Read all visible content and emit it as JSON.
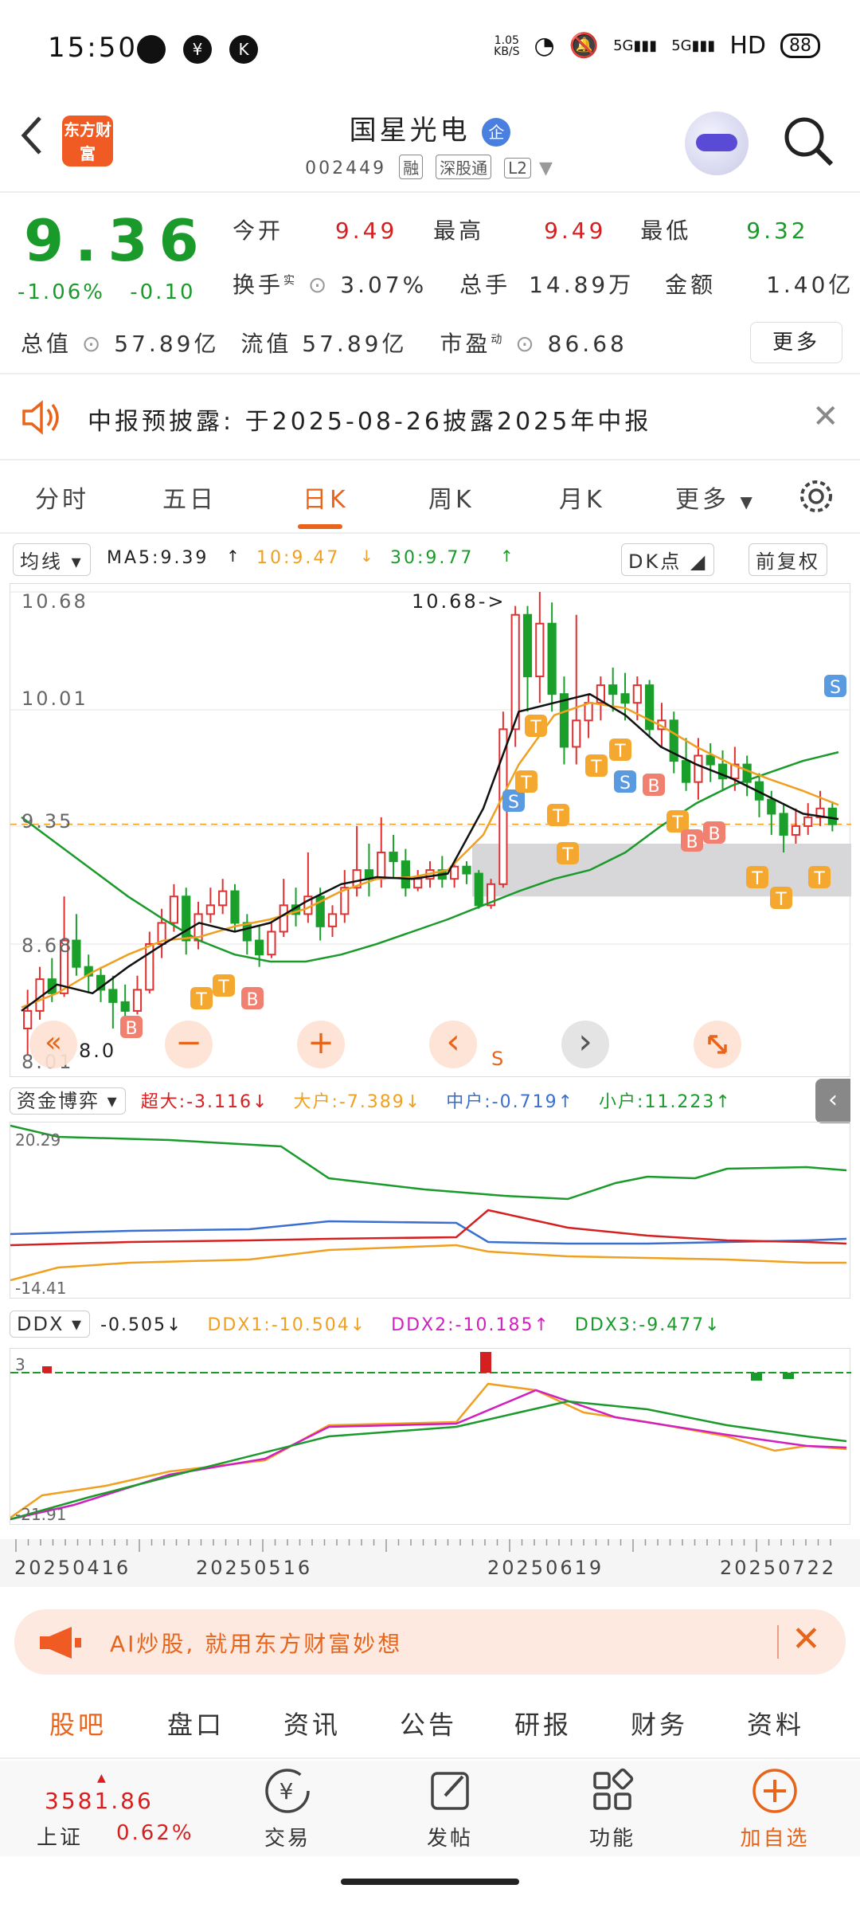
{
  "status_bar": {
    "time": "15:50",
    "net_speed": "1.05",
    "net_unit": "KB/S",
    "network": "HD",
    "battery": "88"
  },
  "header": {
    "logo_text": "东方财富",
    "stock_name": "国星光电",
    "badge": "企",
    "stock_code": "002449",
    "tags": [
      "融",
      "深股通",
      "L2"
    ]
  },
  "quote": {
    "price": "9.36",
    "change_pct": "-1.06%",
    "change_val": "-0.10",
    "open_label": "今开",
    "open": "9.49",
    "high_label": "最高",
    "high": "9.49",
    "low_label": "最低",
    "low": "9.32",
    "turnover_label": "换手",
    "turnover_sup": "实",
    "turnover": "3.07%",
    "volume_label": "总手",
    "volume": "14.89万",
    "amount_label": "金额",
    "amount": "1.40亿",
    "mcap_label": "总值",
    "mcap": "57.89亿",
    "float_label": "流值",
    "float": "57.89亿",
    "pe_label": "市盈",
    "pe_sup": "动",
    "pe": "86.68",
    "more_label": "更多"
  },
  "notice": {
    "text": "中报预披露: 于2025-08-26披露2025年中报"
  },
  "tabs": [
    "分时",
    "五日",
    "日K",
    "周K",
    "月K",
    "更多"
  ],
  "ma": {
    "selector": "均线",
    "ma5": "MA5:9.39",
    "ma10": "10:9.47",
    "ma30": "30:9.77",
    "dk": "DK点",
    "adjust": "前复权"
  },
  "chart_data": {
    "type": "candlestick",
    "ylim": [
      8.01,
      10.68
    ],
    "y_ticks": [
      "10.68",
      "10.01",
      "9.35",
      "8.68",
      "8.01"
    ],
    "max_marker": "10.68->",
    "min_marker": "8.0",
    "x_ticks": [
      "20250416",
      "20250516",
      "20250619",
      "20250722"
    ],
    "colors": {
      "up": "#e03030",
      "down": "#1aa02a",
      "ma5": "#111111",
      "ma10": "#f0a020",
      "ma30": "#1a9a2a"
    },
    "candles": [
      [
        8.2,
        8.3,
        8.05,
        8.42
      ],
      [
        8.3,
        8.48,
        8.25,
        8.55
      ],
      [
        8.48,
        8.4,
        8.35,
        8.6
      ],
      [
        8.4,
        8.7,
        8.38,
        8.95
      ],
      [
        8.7,
        8.55,
        8.5,
        8.85
      ],
      [
        8.55,
        8.5,
        8.4,
        8.62
      ],
      [
        8.5,
        8.42,
        8.35,
        8.55
      ],
      [
        8.42,
        8.35,
        8.2,
        8.5
      ],
      [
        8.35,
        8.3,
        8.25,
        8.45
      ],
      [
        8.3,
        8.42,
        8.28,
        8.5
      ],
      [
        8.42,
        8.68,
        8.4,
        8.75
      ],
      [
        8.68,
        8.8,
        8.6,
        8.88
      ],
      [
        8.8,
        8.95,
        8.75,
        9.02
      ],
      [
        8.95,
        8.7,
        8.62,
        9.0
      ],
      [
        8.7,
        8.85,
        8.65,
        8.92
      ],
      [
        8.85,
        8.9,
        8.8,
        9.0
      ],
      [
        8.9,
        8.98,
        8.85,
        9.05
      ],
      [
        8.98,
        8.8,
        8.75,
        9.02
      ],
      [
        8.8,
        8.7,
        8.62,
        8.85
      ],
      [
        8.7,
        8.62,
        8.55,
        8.78
      ],
      [
        8.62,
        8.75,
        8.6,
        8.8
      ],
      [
        8.75,
        8.9,
        8.72,
        9.05
      ],
      [
        8.9,
        8.85,
        8.78,
        9.0
      ],
      [
        8.85,
        8.95,
        8.8,
        9.2
      ],
      [
        8.95,
        8.78,
        8.7,
        9.0
      ],
      [
        8.78,
        8.85,
        8.72,
        8.9
      ],
      [
        8.85,
        9.0,
        8.8,
        9.1
      ],
      [
        9.0,
        9.1,
        8.95,
        9.35
      ],
      [
        9.1,
        9.05,
        8.95,
        9.25
      ],
      [
        9.05,
        9.2,
        9.0,
        9.4
      ],
      [
        9.2,
        9.15,
        9.05,
        9.3
      ],
      [
        9.15,
        9.0,
        8.95,
        9.22
      ],
      [
        9.0,
        9.05,
        8.98,
        9.1
      ],
      [
        9.05,
        9.1,
        9.0,
        9.15
      ],
      [
        9.1,
        9.05,
        9.0,
        9.18
      ],
      [
        9.05,
        9.12,
        9.0,
        9.15
      ],
      [
        9.12,
        9.08,
        9.02,
        9.15
      ],
      [
        9.08,
        8.9,
        8.88,
        9.1
      ],
      [
        8.9,
        9.02,
        8.88,
        9.05
      ],
      [
        9.02,
        9.9,
        9.0,
        10.0
      ],
      [
        9.9,
        10.55,
        9.8,
        10.6
      ],
      [
        10.55,
        10.2,
        10.0,
        10.6
      ],
      [
        10.2,
        10.5,
        10.05,
        10.68
      ],
      [
        10.5,
        10.1,
        10.0,
        10.62
      ],
      [
        10.1,
        9.8,
        9.7,
        10.2
      ],
      [
        9.8,
        9.95,
        9.7,
        10.55
      ],
      [
        9.95,
        10.05,
        9.85,
        10.1
      ],
      [
        10.05,
        10.15,
        9.95,
        10.2
      ],
      [
        10.15,
        10.1,
        10.0,
        10.25
      ],
      [
        10.1,
        10.05,
        9.95,
        10.22
      ],
      [
        10.05,
        10.15,
        9.95,
        10.2
      ],
      [
        10.15,
        9.9,
        9.85,
        10.18
      ],
      [
        9.9,
        9.95,
        9.8,
        10.05
      ],
      [
        9.95,
        9.72,
        9.65,
        10.0
      ],
      [
        9.72,
        9.6,
        9.55,
        9.85
      ],
      [
        9.6,
        9.75,
        9.5,
        9.85
      ],
      [
        9.75,
        9.7,
        9.6,
        9.82
      ],
      [
        9.7,
        9.62,
        9.55,
        9.78
      ],
      [
        9.62,
        9.7,
        9.55,
        9.8
      ],
      [
        9.7,
        9.6,
        9.52,
        9.75
      ],
      [
        9.6,
        9.5,
        9.4,
        9.65
      ],
      [
        9.5,
        9.42,
        9.3,
        9.55
      ],
      [
        9.42,
        9.3,
        9.2,
        9.48
      ],
      [
        9.3,
        9.35,
        9.25,
        9.45
      ],
      [
        9.35,
        9.4,
        9.3,
        9.48
      ],
      [
        9.4,
        9.45,
        9.35,
        9.55
      ],
      [
        9.45,
        9.36,
        9.32,
        9.49
      ]
    ],
    "ma30": [
      9.4,
      9.25,
      9.1,
      8.95,
      8.82,
      8.7,
      8.62,
      8.58,
      8.58,
      8.62,
      8.68,
      8.75,
      8.82,
      8.9,
      8.98,
      9.05,
      9.1,
      9.2,
      9.35,
      9.48,
      9.58,
      9.65,
      9.72,
      9.77
    ],
    "ma10": [
      8.32,
      8.4,
      8.52,
      8.62,
      8.7,
      8.72,
      8.78,
      8.82,
      8.88,
      8.98,
      9.05,
      9.06,
      9.1,
      9.3,
      9.7,
      9.98,
      10.05,
      10.02,
      9.92,
      9.8,
      9.7,
      9.62,
      9.55,
      9.47
    ],
    "ma5": [
      8.3,
      8.45,
      8.4,
      8.55,
      8.68,
      8.8,
      8.75,
      8.8,
      8.92,
      9.02,
      9.06,
      9.05,
      9.08,
      9.45,
      10.0,
      10.05,
      10.1,
      9.98,
      9.8,
      9.7,
      9.62,
      9.52,
      9.42,
      9.39
    ],
    "bs_markers": [
      "B",
      "T",
      "T",
      "B",
      "S",
      "T",
      "T",
      "T",
      "T",
      "T",
      "T",
      "S",
      "B",
      "T",
      "B",
      "B",
      "T",
      "T",
      "T",
      "S"
    ]
  },
  "chart_controls": {
    "minus": "−",
    "plus": "+",
    "prev": "‹",
    "next": "›",
    "s_label": "S"
  },
  "indicator1": {
    "selector": "资金博弈",
    "super": "超大:-3.116",
    "large": "大户:-7.389",
    "mid": "中户:-0.719",
    "small": "小户:11.223",
    "top_val": "20.29",
    "bot_val": "-14.41"
  },
  "indicator2": {
    "selector": "DDX",
    "ddx": "-0.505",
    "ddx1": "DDX1:-10.504",
    "ddx2": "DDX2:-10.185",
    "ddx3": "DDX3:-9.477",
    "top_val": "3",
    "bot_val": "-21.91"
  },
  "ai_banner": {
    "text": "AI炒股, 就用东方财富妙想"
  },
  "bottom_tabs": [
    "股吧",
    "盘口",
    "资讯",
    "公告",
    "研报",
    "财务",
    "资料"
  ],
  "footer": {
    "index_value": "3581.86",
    "index_name": "上证",
    "index_change": "0.62%",
    "trade": "交易",
    "post": "发帖",
    "function": "功能",
    "add_watch": "加自选"
  }
}
